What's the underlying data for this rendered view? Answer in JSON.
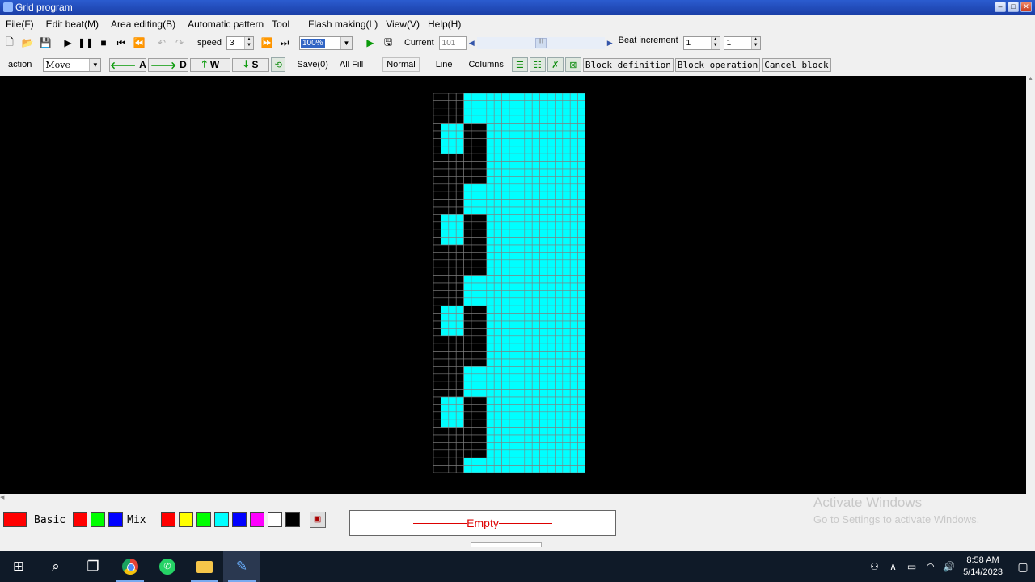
{
  "window": {
    "title": "Grid program"
  },
  "menu": [
    "File(F)",
    "Edit beat(M)",
    "Area editing(B)",
    "Automatic pattern",
    "Tool",
    "Flash making(L)",
    "View(V)",
    "Help(H)"
  ],
  "toolbar1": {
    "speed_label": "speed",
    "speed_value": "3",
    "zoom_value": "100%",
    "current_label": "Current",
    "current_value": "101",
    "beat_increment_label": "Beat increment",
    "beat_increment_a": "1",
    "beat_increment_b": "1"
  },
  "toolbar2": {
    "action_label": "action",
    "action_value": "Move",
    "dir_buttons": [
      "A",
      "D",
      "W",
      "S"
    ],
    "save_label": "Save(0)",
    "all_fill_label": "All Fill",
    "mode_normal": "Normal",
    "mode_line": "Line",
    "mode_columns": "Columns",
    "block_definition": "Block definition",
    "block_operation": "Block operation",
    "cancel_block": "Cancel block"
  },
  "grid": {
    "columns": 20,
    "rows": 50,
    "on_color": "#00ffff",
    "off_color": "#000000",
    "line_color": "#808080",
    "cyan_from_col": 4,
    "black_rects": [
      [
        4,
        0,
        3
      ],
      [
        4,
        4,
        8
      ],
      [
        1,
        4,
        1
      ],
      [
        1,
        8,
        4
      ],
      [
        4,
        12,
        3
      ]
    ],
    "cyan_blocks": [
      [
        1,
        4,
        3
      ],
      [
        1,
        16,
        3
      ],
      [
        1,
        28,
        3
      ],
      [
        1,
        40,
        3
      ]
    ],
    "period": 12
  },
  "palette": {
    "basic_label": "Basic",
    "mix_label": "Mix",
    "current_color": "#ff0000",
    "basic_colors": [
      "#ff0000",
      "#00ff00",
      "#0000ff"
    ],
    "mix_colors": [
      "#ff0000",
      "#ffff00",
      "#00ff00",
      "#00ffff",
      "#0000ff",
      "#ff00ff",
      "#ffffff",
      "#000000"
    ]
  },
  "status": {
    "empty_text": "Empty"
  },
  "watermark": {
    "line1": "Activate Windows",
    "line2": "Go to Settings to activate Windows."
  },
  "taskbar": {
    "time": "8:58 AM",
    "date": "5/14/2023"
  }
}
